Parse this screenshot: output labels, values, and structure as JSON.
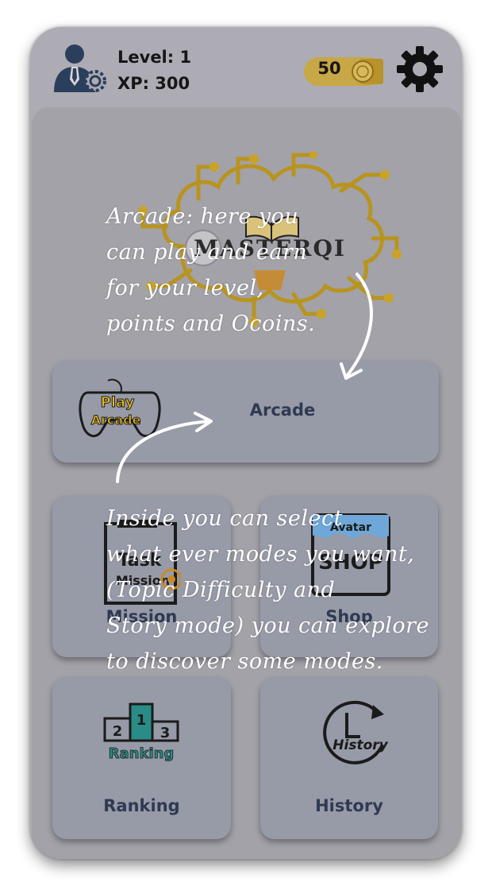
{
  "header": {
    "level_label": "Level: 1",
    "xp_label": "XP: 300",
    "coins": "50",
    "icons": {
      "avatar": "user-gear-icon",
      "coin": "coin-icon",
      "settings": "gear-icon"
    }
  },
  "logo": {
    "text": "MASTERQI",
    "icon": "circuit-brain-logo"
  },
  "menu": {
    "arcade": {
      "label": "Arcade",
      "icon_text": [
        "Play",
        "Arcade"
      ]
    },
    "mission": {
      "label": "Mission",
      "icon_text": [
        "Task",
        "Mission"
      ]
    },
    "shop": {
      "label": "Shop",
      "icon_text": [
        "Avatar",
        "SHOP"
      ]
    },
    "ranking": {
      "label": "Ranking",
      "icon_text": [
        "2",
        "1",
        "3",
        "Ranking"
      ]
    },
    "history": {
      "label": "History",
      "icon_text": [
        "History"
      ]
    }
  },
  "tutorial": {
    "note_arcade": [
      "Arcade: here you",
      "can play and earn",
      "for your level,",
      "points and Ocoins."
    ],
    "note_modes": [
      "Inside you can select",
      "what ever modes you want,",
      "(Topic Difficulty and",
      "Story mode) you can explore",
      "to discover some modes."
    ]
  },
  "colors": {
    "overlay_bg": "#adacb4",
    "card": "#979aa7",
    "label": "#2f3a52",
    "gold": "#c9a227",
    "teal": "#2a8c86"
  }
}
